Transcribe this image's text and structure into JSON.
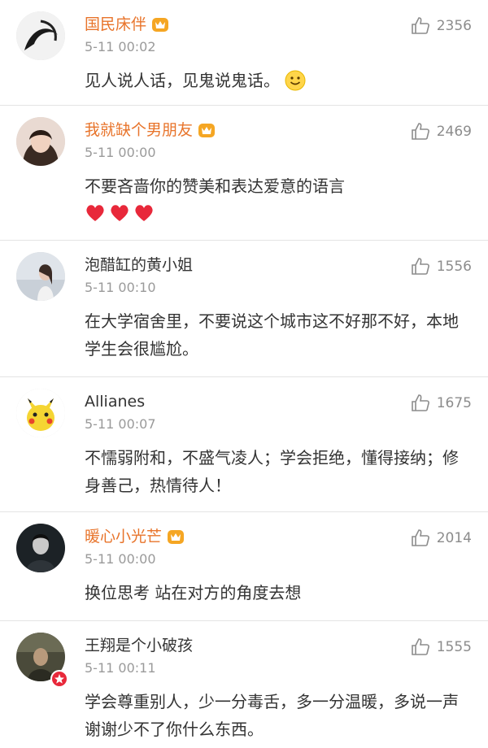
{
  "comments": [
    {
      "name": "国民床伴",
      "vip": true,
      "time": "5-11 00:02",
      "text": "见人说人话，见鬼说鬼话。",
      "emoji": "smile-emoji",
      "likes": "2356"
    },
    {
      "name": "我就缺个男朋友",
      "vip": true,
      "time": "5-11 00:00",
      "text": "不要吝啬你的赞美和表达爱意的语言",
      "hearts": 3,
      "likes": "2469"
    },
    {
      "name": "泡醋缸的黄小姐",
      "vip": false,
      "time": "5-11 00:10",
      "text": "在大学宿舍里，不要说这个城市这不好那不好，本地学生会很尴尬。",
      "likes": "1556"
    },
    {
      "name": "Allianes",
      "vip": false,
      "time": "5-11 00:07",
      "text": "不懦弱附和，不盛气凌人；学会拒绝，懂得接纳；修身善己，热情待人！",
      "likes": "1675"
    },
    {
      "name": "暖心小光芒",
      "vip": true,
      "time": "5-11 00:00",
      "text": "换位思考 站在对方的角度去想",
      "likes": "2014"
    },
    {
      "name": "王翔是个小破孩",
      "vip": false,
      "time": "5-11 00:11",
      "text": "学会尊重别人，少一分毒舌，多一分温暖，多说一声谢谢少不了你什么东西。",
      "likes": "1555"
    }
  ],
  "colors": {
    "vip_name": "#e8742b",
    "meta": "#9a9a9a",
    "divider": "#e4e4e4",
    "heart": "#e8283a"
  },
  "icons": {
    "like": "thumbs-up-icon",
    "vip": "vip-crown-icon"
  }
}
